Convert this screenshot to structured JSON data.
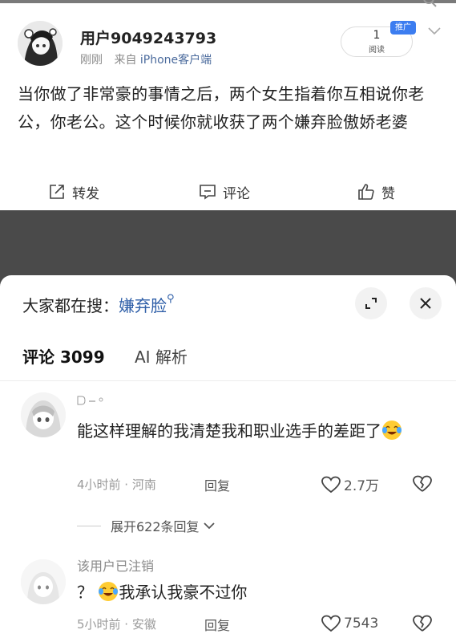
{
  "post": {
    "username": "用户9049243793",
    "time": "刚刚",
    "source_prefix": "来自",
    "source": "iPhone客户端",
    "read_count": "1",
    "read_label": "阅读",
    "promo_badge": "推广",
    "text": "当你做了非常豪的事情之后，两个女生指着你互相说你老公，你老公。这个时候你就收获了两个嫌弃脸傲娇老婆",
    "actions": {
      "repost": "转发",
      "comment": "评论",
      "like": "赞"
    }
  },
  "sheet": {
    "hot_search_label": "大家都在搜：",
    "hot_search_keyword": "嫌弃脸",
    "tabs": {
      "comments": "评论 3099",
      "ai": "AI 解析"
    },
    "comments": [
      {
        "text": "能这样理解的我清楚我和职业选手的差距了",
        "time_loc": "4小时前 · 河南",
        "reply": "回复",
        "likes": "2.7万",
        "expand": "展开622条回复"
      },
      {
        "name": "该用户已注销",
        "text_prefix": "？",
        "text": "我承认我豪不过你",
        "time_loc": "5小时前 · 安徽",
        "reply": "回复",
        "likes": "7543"
      }
    ]
  },
  "colors": {
    "accent_blue": "#3c7df0",
    "link_blue": "#2f5fa8",
    "overlay": "#4a4a4a"
  }
}
